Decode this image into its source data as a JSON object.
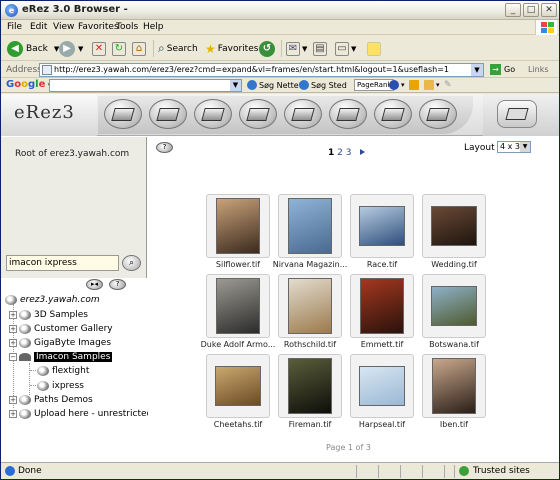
{
  "window": {
    "title": "eRez 3.0 Browser -"
  },
  "menu": [
    "File",
    "Edit",
    "View",
    "Favorites",
    "Tools",
    "Help"
  ],
  "toolbar": {
    "back": "Back",
    "search": "Search",
    "favorites": "Favorites"
  },
  "address": {
    "label": "Address",
    "url": "http://erez3.yawah.com/erez3/erez?cmd=expand&vl=frames/en/start.html&logout=1&useflash=1",
    "go": "Go",
    "links": "Links"
  },
  "googlebar": {
    "logo": "Google",
    "search_web": "Søg Nettet",
    "search_site": "Søg Sted",
    "pagerank": "PageRank"
  },
  "app": {
    "logo": "eRez3"
  },
  "sidebar": {
    "root_label": "Root of erez3.yawah.com",
    "search_value": "imacon ixpress",
    "tree": {
      "root": "erez3.yawah.com",
      "items": [
        {
          "label": "3D Samples",
          "expanded": false,
          "selected": false
        },
        {
          "label": "Customer Gallery",
          "expanded": false,
          "selected": false
        },
        {
          "label": "GigaByte Images",
          "expanded": false,
          "selected": false
        },
        {
          "label": "Imacon Samples",
          "expanded": true,
          "selected": true
        },
        {
          "label": "flextight",
          "expanded": false,
          "selected": false
        },
        {
          "label": "ixpress",
          "expanded": false,
          "selected": false
        },
        {
          "label": "Paths Demos",
          "expanded": false,
          "selected": false
        },
        {
          "label": "Upload here - unrestricted",
          "expanded": false,
          "selected": false
        }
      ]
    }
  },
  "main": {
    "layout_label": "Layout",
    "layout_value": "4 x 3",
    "pagination": {
      "current": "1",
      "pages": [
        "2",
        "3"
      ]
    },
    "thumbnails": [
      {
        "caption": "Silflower.tif",
        "colors": [
          "#c9a27a",
          "#3b2a1e"
        ]
      },
      {
        "caption": "Nirvana Magazin...",
        "colors": [
          "#8fb3d6",
          "#4a6a90"
        ]
      },
      {
        "caption": "Race.tif",
        "colors": [
          "#b7cbe0",
          "#2e4f7c"
        ]
      },
      {
        "caption": "Wedding.tif",
        "colors": [
          "#6a4a36",
          "#1e140e"
        ]
      },
      {
        "caption": "Duke Adolf Armo...",
        "colors": [
          "#9c9a92",
          "#2b2b2b"
        ]
      },
      {
        "caption": "Rothschild.tif",
        "colors": [
          "#e2dccf",
          "#9c7a4c"
        ]
      },
      {
        "caption": "Emmett.tif",
        "colors": [
          "#a43820",
          "#2a120c"
        ]
      },
      {
        "caption": "Botswana.tif",
        "colors": [
          "#8fb1c8",
          "#4e5a2e"
        ]
      },
      {
        "caption": "Cheetahs.tif",
        "colors": [
          "#caa86e",
          "#6b4a26"
        ]
      },
      {
        "caption": "Fireman.tif",
        "colors": [
          "#5a5e3a",
          "#0e0e0a"
        ]
      },
      {
        "caption": "Harpseal.tif",
        "colors": [
          "#d8e6f2",
          "#9ab8d4"
        ]
      },
      {
        "caption": "Iben.tif",
        "colors": [
          "#c9a88c",
          "#2a1e18"
        ]
      }
    ],
    "page_of": "Page 1 of 3"
  },
  "status": {
    "done": "Done",
    "zone": "Trusted sites"
  }
}
